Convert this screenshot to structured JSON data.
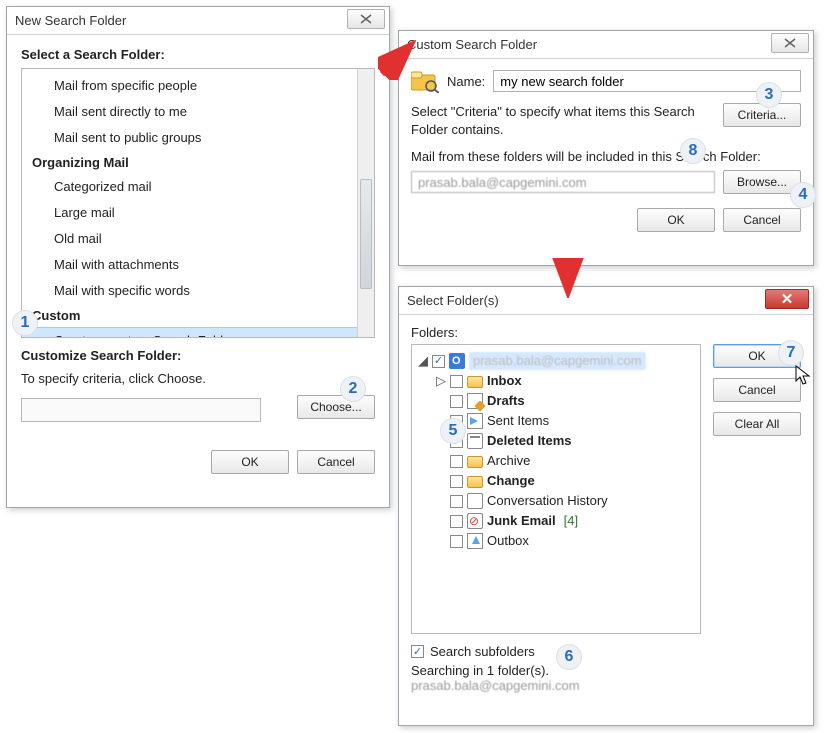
{
  "dlg1": {
    "title": "New Search Folder",
    "section_label": "Select a Search Folder:",
    "items": [
      "Mail from specific people",
      "Mail sent directly to me",
      "Mail sent to public groups"
    ],
    "group_organizing": "Organizing Mail",
    "items2": [
      "Categorized mail",
      "Large mail",
      "Old mail",
      "Mail with attachments",
      "Mail with specific words"
    ],
    "group_custom": "Custom",
    "item_custom": "Create a custom Search Folder",
    "customize_label": "Customize Search Folder:",
    "criteria_text": "To specify criteria, click Choose.",
    "choose": "Choose...",
    "ok": "OK",
    "cancel": "Cancel"
  },
  "dlg2": {
    "title": "Custom Search Folder",
    "name_label": "Name:",
    "name_value": "my new search folder",
    "criteria_text": "Select \"Criteria\" to specify what items this Search Folder contains.",
    "criteria_btn": "Criteria...",
    "include_label": "Mail from these folders will be included in this Search Folder:",
    "include_value": "prasab.bala@capgemini.com",
    "browse": "Browse...",
    "ok": "OK",
    "cancel": "Cancel"
  },
  "dlg3": {
    "title": "Select Folder(s)",
    "folders_label": "Folders:",
    "root": "prasab.bala@capgemini.com",
    "tree": [
      {
        "label": "Inbox",
        "bold": true,
        "icon": "inbox",
        "expandable": true
      },
      {
        "label": "Drafts",
        "bold": true,
        "icon": "drafts"
      },
      {
        "label": "Sent Items",
        "bold": false,
        "icon": "sent"
      },
      {
        "label": "Deleted Items",
        "bold": true,
        "icon": "deleted"
      },
      {
        "label": "Archive",
        "bold": false,
        "icon": "archive"
      },
      {
        "label": "Change",
        "bold": true,
        "icon": "change"
      },
      {
        "label": "Conversation History",
        "bold": false,
        "icon": "conv"
      },
      {
        "label": "Junk Email",
        "bold": true,
        "icon": "junk",
        "count": "[4]"
      },
      {
        "label": "Outbox",
        "bold": false,
        "icon": "outbox"
      }
    ],
    "ok": "OK",
    "cancel": "Cancel",
    "clear_all": "Clear All",
    "search_subfolders": "Search subfolders",
    "searching_text": "Searching in 1 folder(s).",
    "searching_path": "prasab.bala@capgemini.com"
  }
}
